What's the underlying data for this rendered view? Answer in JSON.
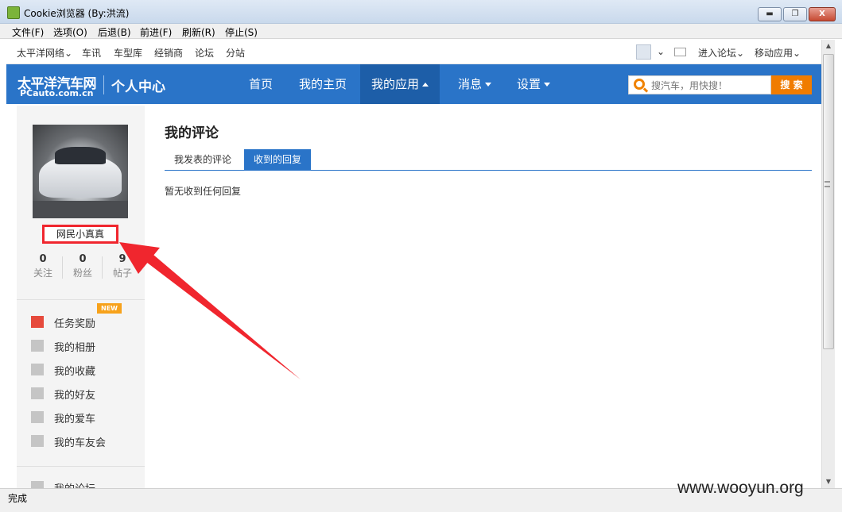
{
  "window": {
    "title": "Cookie浏览器 (By:洪流)",
    "minimize_glyph": "▬",
    "maximize_glyph": "❐",
    "close_glyph": "X"
  },
  "menubar": [
    "文件(F)",
    "选项(O)",
    "后退(B)",
    "前进(F)",
    "刷新(R)",
    "停止(S)"
  ],
  "sitenav": {
    "items": [
      "太平洋网络",
      "车讯",
      "车型库",
      "经销商",
      "论坛",
      "分站"
    ],
    "right_items": [
      "进入论坛",
      "移动应用"
    ],
    "dropdown_glyph": "⌄"
  },
  "header": {
    "logo_main": "太平洋汽车网",
    "logo_sub": "PCauto.com.cn",
    "title": "个人中心",
    "nav": [
      "首页",
      "我的主页",
      "我的应用",
      "消息",
      "设置"
    ],
    "search_placeholder": "搜汽车，用快搜！",
    "search_button": "搜 索"
  },
  "profile": {
    "username": "网民小真真",
    "stats": [
      {
        "num": "0",
        "label": "关注"
      },
      {
        "num": "0",
        "label": "粉丝"
      },
      {
        "num": "9",
        "label": "帖子"
      }
    ],
    "new_badge": "NEW"
  },
  "sidebar_menu": [
    "任务奖励",
    "我的相册",
    "我的收藏",
    "我的好友",
    "我的爱车",
    "我的车友会",
    "我的论坛"
  ],
  "main": {
    "title": "我的评论",
    "tabs": [
      "我发表的评论",
      "收到的回复"
    ],
    "empty_text": "暂无收到任何回复"
  },
  "status": "完成",
  "watermark": "www.wooyun.org",
  "colors": {
    "brand_blue": "#2a74c8",
    "search_orange": "#f07c00",
    "highlight_red": "#f0262e"
  }
}
